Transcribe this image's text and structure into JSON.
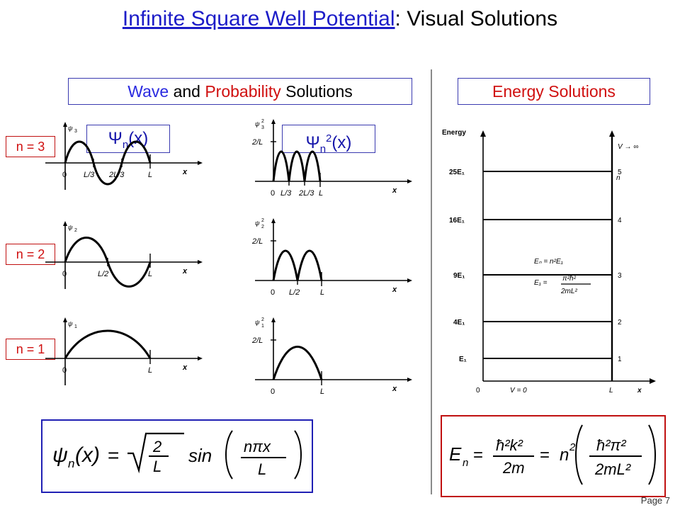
{
  "title": {
    "underlined_part": "Infinite Square Well Potential",
    "rest": ": Visual Solutions"
  },
  "headers": {
    "wave_word": "Wave",
    "wave_and": " and ",
    "prob_word": "Probability",
    "wave_tail": " Solutions",
    "energy": "Energy Solutions"
  },
  "function_labels": {
    "psi": "Ψ",
    "psi_sub": "n",
    "psi_arg": "(x)",
    "psi2_sup": "2"
  },
  "n_labels": [
    {
      "name": "n3",
      "text": "n = 3"
    },
    {
      "name": "n2",
      "text": "n = 2"
    },
    {
      "name": "n1",
      "text": "n = 1"
    }
  ],
  "wave_plots": [
    {
      "id": "psi3",
      "curve_label": "ψ",
      "curve_sub": "3",
      "xticks": [
        "0",
        "L/3",
        "2L/3",
        "L"
      ],
      "xaxis": "x",
      "yticks": []
    },
    {
      "id": "psi2",
      "curve_label": "ψ",
      "curve_sub": "2",
      "xticks": [
        "0",
        "L/2",
        "L"
      ],
      "xaxis": "x",
      "yticks": []
    },
    {
      "id": "psi1",
      "curve_label": "ψ",
      "curve_sub": "1",
      "xticks": [
        "0",
        "L"
      ],
      "xaxis": "x",
      "yticks": []
    }
  ],
  "prob_plots": [
    {
      "id": "psi3sq",
      "curve_label": "ψ",
      "curve_sub": "3",
      "curve_sup": "2",
      "xticks": [
        "0",
        "L/3",
        "2L/3",
        "L"
      ],
      "xaxis": "x",
      "yticks": [
        "2/L"
      ]
    },
    {
      "id": "psi2sq",
      "curve_label": "ψ",
      "curve_sub": "2",
      "curve_sup": "2",
      "xticks": [
        "0",
        "L/2",
        "L"
      ],
      "xaxis": "x",
      "yticks": [
        "2/L"
      ]
    },
    {
      "id": "psi1sq",
      "curve_label": "ψ",
      "curve_sub": "1",
      "curve_sup": "2",
      "xticks": [
        "0",
        "L"
      ],
      "xaxis": "x",
      "yticks": [
        "2/L"
      ]
    }
  ],
  "energy_diagram": {
    "yaxis_label": "Energy",
    "xaxis_label": "x",
    "x_origin": "0",
    "x_end": "L",
    "inside_label": "V = 0",
    "wall_label": "V → ∞",
    "n_column_header": "n",
    "levels": [
      {
        "energy": "E1",
        "energy_label": "E₁",
        "n": "1",
        "value": 1
      },
      {
        "energy": "4E1",
        "energy_label": "4E₁",
        "n": "2",
        "value": 4
      },
      {
        "energy": "9E1",
        "energy_label": "9E₁",
        "n": "3",
        "value": 9
      },
      {
        "energy": "16E1",
        "energy_label": "16E₁",
        "n": "4",
        "value": 16
      },
      {
        "energy": "25E1",
        "energy_label": "25E₁",
        "n": "5",
        "value": 25
      }
    ],
    "inset_formula_line1": "Eₙ = n²E₁",
    "inset_formula_line2_num": "π²ħ²",
    "inset_formula_line2_den": "2mL²",
    "inset_formula_line2_lhs": "E₁ ="
  },
  "wave_formula": {
    "lhs": "ψ",
    "lhs_sub": "n",
    "lhs_arg": "(x)",
    "equals": "=",
    "sqrt_num": "2",
    "sqrt_den": "L",
    "sin": "sin",
    "frac_num": "nπx",
    "frac_den": "L"
  },
  "energy_formula": {
    "lhs": "E",
    "lhs_sub": "n",
    "equals": "=",
    "t1_num": "ħ²k²",
    "t1_den": "2m",
    "equals2": "=",
    "coef": "n",
    "coef_sup": "2",
    "t2_num": "ħ²π²",
    "t2_den": "2mL²"
  },
  "page": "Page 7",
  "colors": {
    "title_blue": "#1c1cc8",
    "red": "#d01010",
    "blue": "#2a2ae0",
    "box_blue": "#3a3ab0",
    "divider": "#8a8a8a"
  }
}
